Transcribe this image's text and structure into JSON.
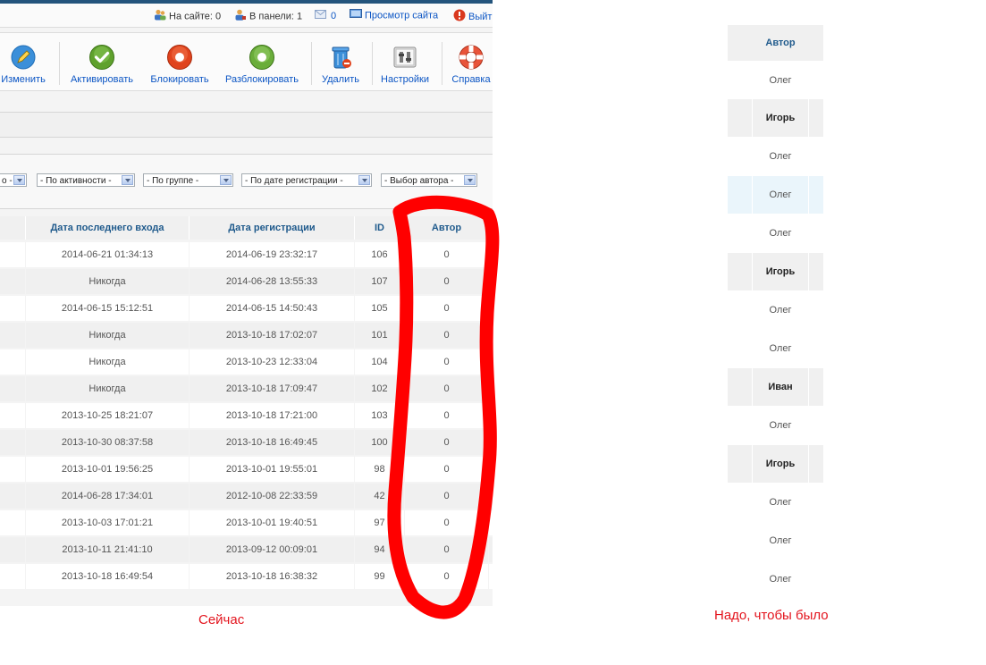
{
  "statusbar": {
    "on_site": "На сайте: 0",
    "in_panel": "В панели: 1",
    "messages": "0",
    "view_site": "Просмотр сайта",
    "logout": "Выйт"
  },
  "toolbar": {
    "edit": "Изменить",
    "activate": "Активировать",
    "block": "Блокировать",
    "unblock": "Разблокировать",
    "delete": "Удалить",
    "settings": "Настройки",
    "help": "Справка"
  },
  "filters": {
    "state_suffix": "о -",
    "activity": "- По активности -",
    "group": "- По группе -",
    "reg_date": "- По дате регистрации -",
    "author": "- Выбор автора -"
  },
  "table": {
    "headers": {
      "last_visit": "Дата последнего входа",
      "registered": "Дата регистрации",
      "id": "ID",
      "author": "Автор"
    },
    "rows": [
      {
        "last_visit": "2014-06-21 01:34:13",
        "registered": "2014-06-19 23:32:17",
        "id": "106",
        "author": "0"
      },
      {
        "last_visit": "Никогда",
        "registered": "2014-06-28 13:55:33",
        "id": "107",
        "author": "0"
      },
      {
        "last_visit": "2014-06-15 15:12:51",
        "registered": "2014-06-15 14:50:43",
        "id": "105",
        "author": "0"
      },
      {
        "last_visit": "Никогда",
        "registered": "2013-10-18 17:02:07",
        "id": "101",
        "author": "0"
      },
      {
        "last_visit": "Никогда",
        "registered": "2013-10-23 12:33:04",
        "id": "104",
        "author": "0"
      },
      {
        "last_visit": "Никогда",
        "registered": "2013-10-18 17:09:47",
        "id": "102",
        "author": "0"
      },
      {
        "last_visit": "2013-10-25 18:21:07",
        "registered": "2013-10-18 17:21:00",
        "id": "103",
        "author": "0"
      },
      {
        "last_visit": "2013-10-30 08:37:58",
        "registered": "2013-10-18 16:49:45",
        "id": "100",
        "author": "0"
      },
      {
        "last_visit": "2013-10-01 19:56:25",
        "registered": "2013-10-01 19:55:01",
        "id": "98",
        "author": "0"
      },
      {
        "last_visit": "2014-06-28 17:34:01",
        "registered": "2012-10-08 22:33:59",
        "id": "42",
        "author": "0"
      },
      {
        "last_visit": "2013-10-03 17:01:21",
        "registered": "2013-10-01 19:40:51",
        "id": "97",
        "author": "0"
      },
      {
        "last_visit": "2013-10-11 21:41:10",
        "registered": "2013-09-12 00:09:01",
        "id": "94",
        "author": "0"
      },
      {
        "last_visit": "2013-10-18 16:49:54",
        "registered": "2013-10-18 16:38:32",
        "id": "99",
        "author": "0"
      }
    ]
  },
  "captions": {
    "now": "Сейчас",
    "wanted": "Надо, чтобы было"
  },
  "desired": {
    "header": "Автор",
    "rows": [
      {
        "author": "Олег",
        "bold": false
      },
      {
        "author": "Игорь",
        "bold": true
      },
      {
        "author": "Олег",
        "bold": false
      },
      {
        "author": "Олег",
        "bold": false
      },
      {
        "author": "Олег",
        "bold": false
      },
      {
        "author": "Игорь",
        "bold": true
      },
      {
        "author": "Олег",
        "bold": false
      },
      {
        "author": "Олег",
        "bold": false
      },
      {
        "author": "Иван",
        "bold": true
      },
      {
        "author": "Олег",
        "bold": false
      },
      {
        "author": "Игорь",
        "bold": true
      },
      {
        "author": "Олег",
        "bold": false
      },
      {
        "author": "Олег",
        "bold": false
      },
      {
        "author": "Олег",
        "bold": false
      }
    ]
  },
  "colors": {
    "header_text": "#1f5a8c",
    "link": "#0b55c4",
    "annotation": "#ff0000",
    "caption": "#e3141d"
  }
}
